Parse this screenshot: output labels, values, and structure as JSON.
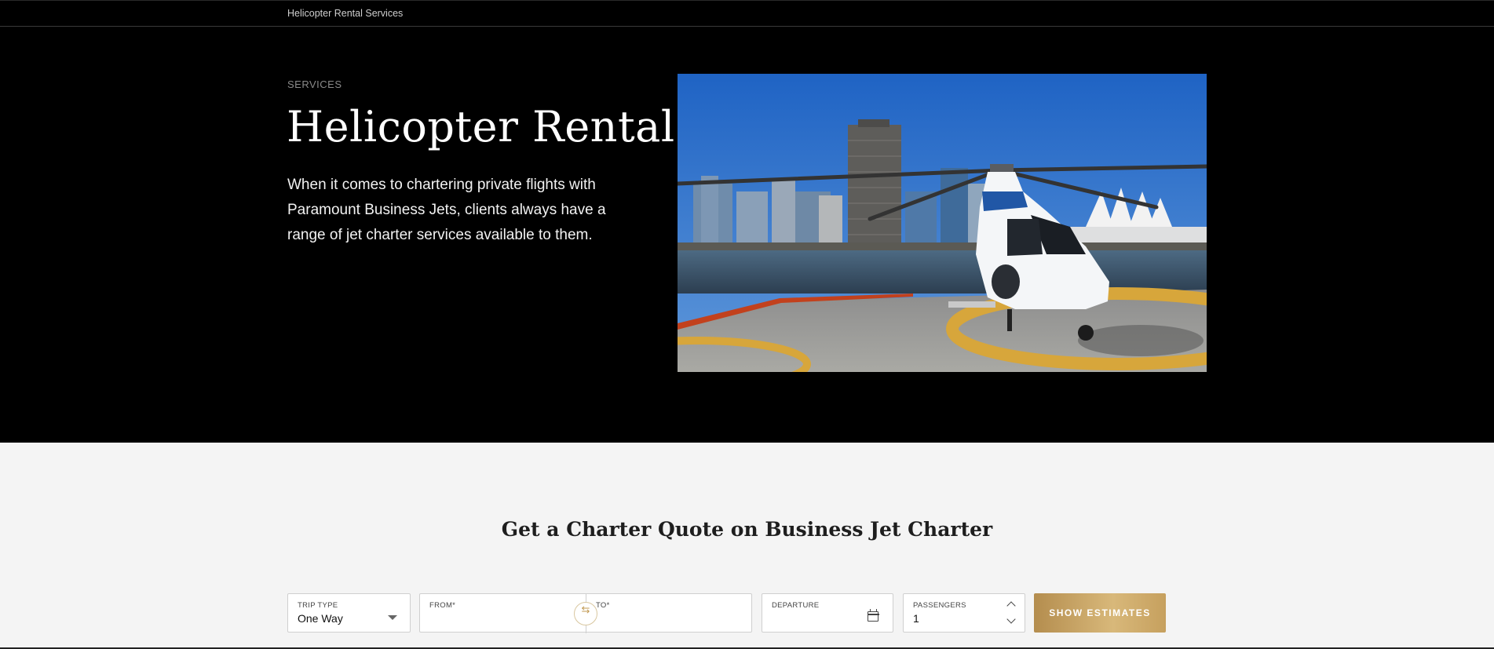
{
  "breadcrumb": {
    "label": "Helicopter Rental Services"
  },
  "hero": {
    "eyebrow": "SERVICES",
    "title": "Helicopter Rental",
    "description": "When it comes to chartering private flights with Paramount Business Jets, clients always have a range of jet charter services available to them."
  },
  "quote": {
    "title": "Get a Charter Quote on Business Jet Charter",
    "trip_type": {
      "label": "TRIP TYPE",
      "value": "One Way"
    },
    "from": {
      "label": "FROM*"
    },
    "to": {
      "label": "TO*"
    },
    "departure": {
      "label": "DEPARTURE"
    },
    "passengers": {
      "label": "PASSENGERS",
      "value": "1"
    },
    "submit_label": "SHOW ESTIMATES"
  },
  "colors": {
    "accent_gold": "#c6a05e",
    "hero_bg": "#000000",
    "section_bg": "#f4f4f4"
  },
  "icons": {
    "swap": "swap-arrows-icon",
    "calendar": "calendar-icon",
    "caret": "caret-down-icon"
  }
}
